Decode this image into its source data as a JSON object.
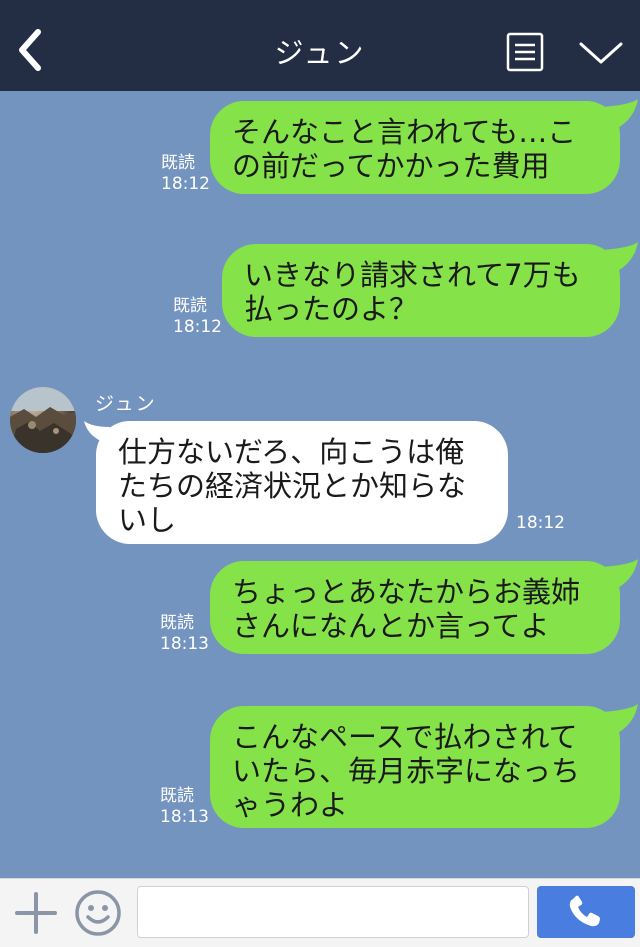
{
  "header": {
    "title": "ジュン",
    "back_icon": "chevron-left-icon",
    "menu_icon": "list-icon",
    "collapse_icon": "chevron-down-icon"
  },
  "messages": [
    {
      "direction": "out",
      "text": "そんなこと言われても…こ\nの前だってかかった費用",
      "read": "既読",
      "time": "18:12"
    },
    {
      "direction": "out",
      "text": "いきなり請求されて7万も\n払ったのよ？",
      "read": "既読",
      "time": "18:12"
    },
    {
      "direction": "in",
      "sender": "ジュン",
      "text": "仕方ないだろ、向こうは俺\nたちの経済状況とか知らな\nいし",
      "time": "18:12"
    },
    {
      "direction": "out",
      "text": "ちょっとあなたからお義姉\nさんになんとか言ってよ",
      "read": "既読",
      "time": "18:13"
    },
    {
      "direction": "out",
      "text": "こんなペースで払わされて\nいたら、毎月赤字になっち\nゃうわよ",
      "read": "既読",
      "time": "18:13"
    }
  ],
  "composer": {
    "plus_icon": "plus-icon",
    "emoji_icon": "smiley-icon",
    "input_value": "",
    "call_icon": "phone-icon"
  },
  "colors": {
    "header_bg": "#232d44",
    "chat_bg": "#7494c0",
    "outgoing_bubble": "#85e249",
    "incoming_bubble": "#ffffff",
    "call_button": "#4a7de0"
  }
}
